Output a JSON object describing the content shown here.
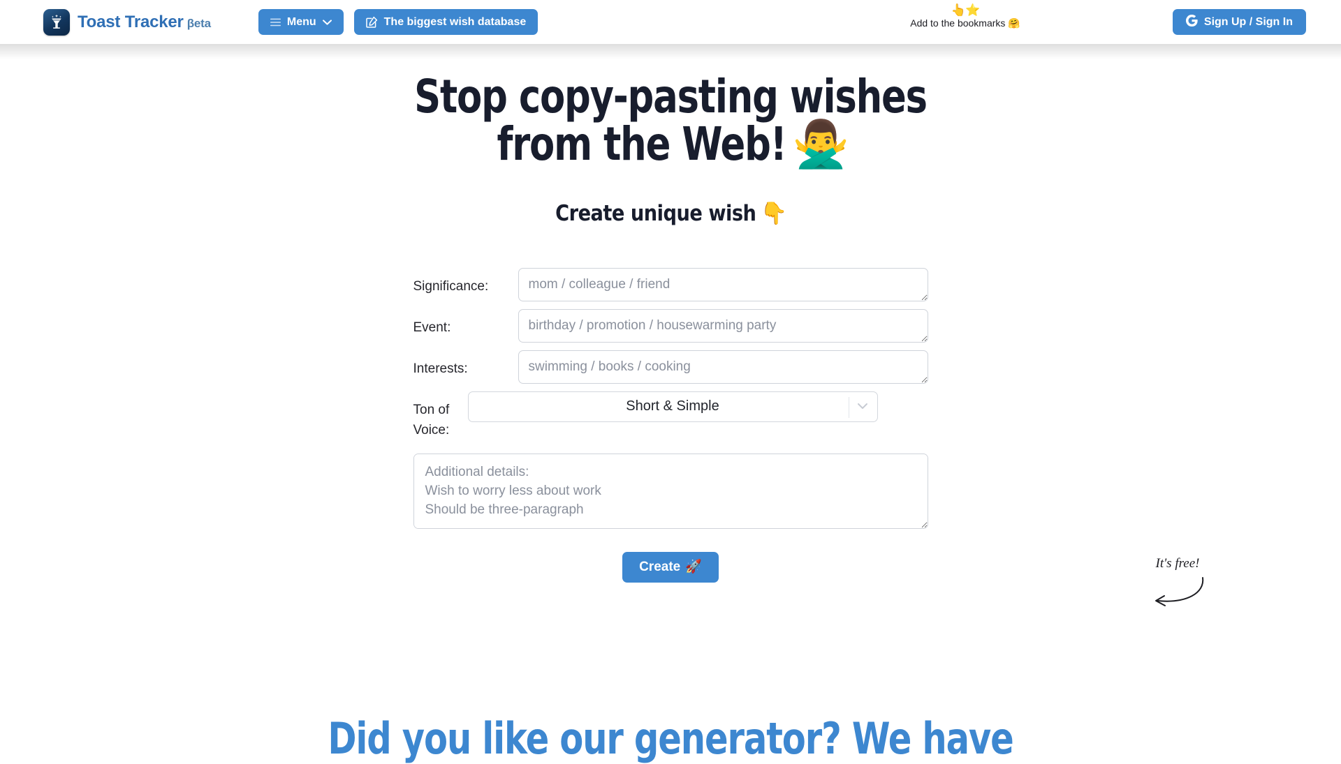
{
  "header": {
    "brand": {
      "logo_icon": "cocktail-glass-sparkle-icon",
      "name": "Toast Tracker",
      "beta": "βeta"
    },
    "nav": [
      {
        "id": "menu",
        "icon": "hamburger-icon",
        "label": "Menu",
        "chevron": "chevron-down-icon"
      },
      {
        "id": "database",
        "icon": "edit-square-icon",
        "label": "The biggest wish database"
      }
    ],
    "bookmark": {
      "emojis": "👆⭐",
      "text": "Add to the bookmarks 🤗"
    },
    "signin": {
      "icon": "google-g-icon",
      "label": "Sign Up / Sign In"
    }
  },
  "hero": {
    "headline_line1": "Stop copy-pasting wishes",
    "headline_line2": "from the Web!",
    "headline_emoji": "🙅‍♂️",
    "subhead": "Create unique wish",
    "subhead_emoji": "👇"
  },
  "form": {
    "fields": [
      {
        "id": "significance",
        "label": "Significance:",
        "placeholder": "mom / colleague / friend",
        "value": ""
      },
      {
        "id": "event",
        "label": "Event:",
        "placeholder": "birthday / promotion / housewarming party",
        "value": ""
      },
      {
        "id": "interests",
        "label": "Interests:",
        "placeholder": "swimming / books / cooking",
        "value": ""
      }
    ],
    "tone": {
      "label": "Ton of Voice:",
      "selected": "Short & Simple",
      "options": [
        "Short & Simple"
      ]
    },
    "details": {
      "placeholder": "Additional details:\nWish to worry less about work\nShould be three-paragraph",
      "value": ""
    },
    "submit": {
      "label": "Create",
      "emoji": "🚀"
    },
    "free_note": "It's free!"
  },
  "bottom": {
    "heading": "Did you like our generator? We have"
  },
  "colors": {
    "accent_blue": "#3d87d0",
    "brand_blue": "#2f6fb5",
    "headline_dark": "#181d2d",
    "placeholder_gray": "#8a909c",
    "border_gray": "#cfd3da"
  }
}
